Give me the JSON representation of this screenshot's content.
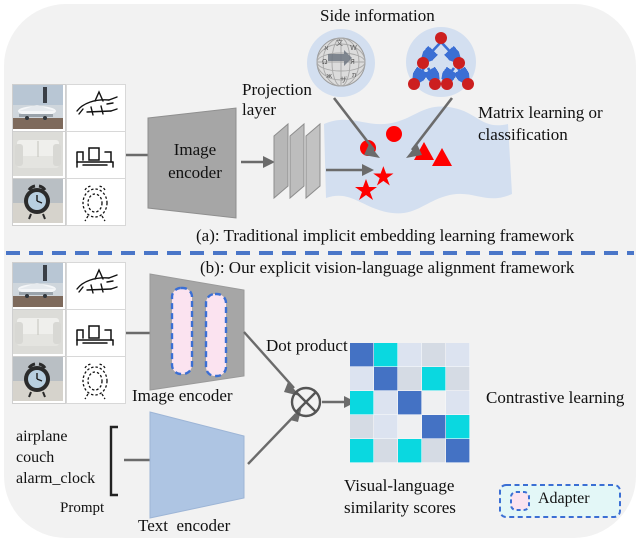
{
  "figure": {
    "background_color": "#f2f2f2",
    "accent_blue": "#4472c4",
    "divider_color": "#4a76c8",
    "red": "#ff0000",
    "gray_encoder": "#a0a0a0",
    "light_blue": "#b9cde5",
    "adapter_pink": "#fbe3f0"
  },
  "section_a": {
    "caption": "(a): Traditional implicit embedding learning framework",
    "image_encoder_line1": "Image",
    "image_encoder_line2": "encoder",
    "projection_line1": "Projection",
    "projection_line2": "layer",
    "side_information": "Side information",
    "matrix_line1": "Matrix learning or",
    "matrix_line2": "classification",
    "side_icons": [
      {
        "name": "wikipedia-globe-icon",
        "label": "Wikipedia"
      },
      {
        "name": "hierarchy-graph-icon",
        "label": "Hierarchy graph"
      }
    ],
    "thumbnails": [
      {
        "photo": "airplane-photo",
        "sketch": "airplane-sketch"
      },
      {
        "photo": "couch-photo",
        "sketch": "couch-sketch"
      },
      {
        "photo": "alarm-clock-photo",
        "sketch": "alarm-clock-sketch"
      }
    ],
    "embedding_markers": [
      {
        "shape": "circle",
        "color": "#ff0000"
      },
      {
        "shape": "circle",
        "color": "#ff0000"
      },
      {
        "shape": "triangle",
        "color": "#ff0000"
      },
      {
        "shape": "triangle",
        "color": "#ff0000"
      },
      {
        "shape": "star",
        "color": "#ff0000"
      },
      {
        "shape": "star",
        "color": "#ff0000"
      }
    ]
  },
  "section_b": {
    "caption": "(b): Our explicit vision-language alignment framework",
    "image_encoder": "Image encoder",
    "text_encoder": "Text  encoder",
    "dot_product": "Dot product",
    "contrastive_learning": "Contrastive learning",
    "similarity_line1": "Visual-language",
    "similarity_line2": "similarity scores",
    "prompt_label": "Prompt",
    "prompt_items": [
      "airplane",
      "couch",
      "alarm_clock"
    ],
    "thumbnails": [
      {
        "photo": "airplane-photo",
        "sketch": "airplane-sketch"
      },
      {
        "photo": "couch-photo",
        "sketch": "couch-sketch"
      },
      {
        "photo": "alarm-clock-photo",
        "sketch": "alarm-clock-sketch"
      }
    ],
    "adapter_count": 2
  },
  "legend": {
    "adapter_label": "Adapter",
    "box_fill": "#e3f7f7",
    "box_border": "#4472c4",
    "icon_fill": "#fbe3f0"
  },
  "chart_data": {
    "type": "heatmap",
    "title": "Visual-language similarity scores",
    "rows": 5,
    "cols": 5,
    "colors": {
      "high": "#4472c4",
      "mid": "#0ad8e0",
      "low1": "#dce3f0",
      "low2": "#d5dbe4",
      "low3": "#eff0f2"
    },
    "grid": [
      [
        "high",
        "mid",
        "low1",
        "low2",
        "low1"
      ],
      [
        "low1",
        "high",
        "low2",
        "mid",
        "low2"
      ],
      [
        "mid",
        "low1",
        "high",
        "low3",
        "low1"
      ],
      [
        "low2",
        "low1",
        "low3",
        "high",
        "mid"
      ],
      [
        "mid",
        "low2",
        "mid",
        "low2",
        "high"
      ]
    ]
  }
}
